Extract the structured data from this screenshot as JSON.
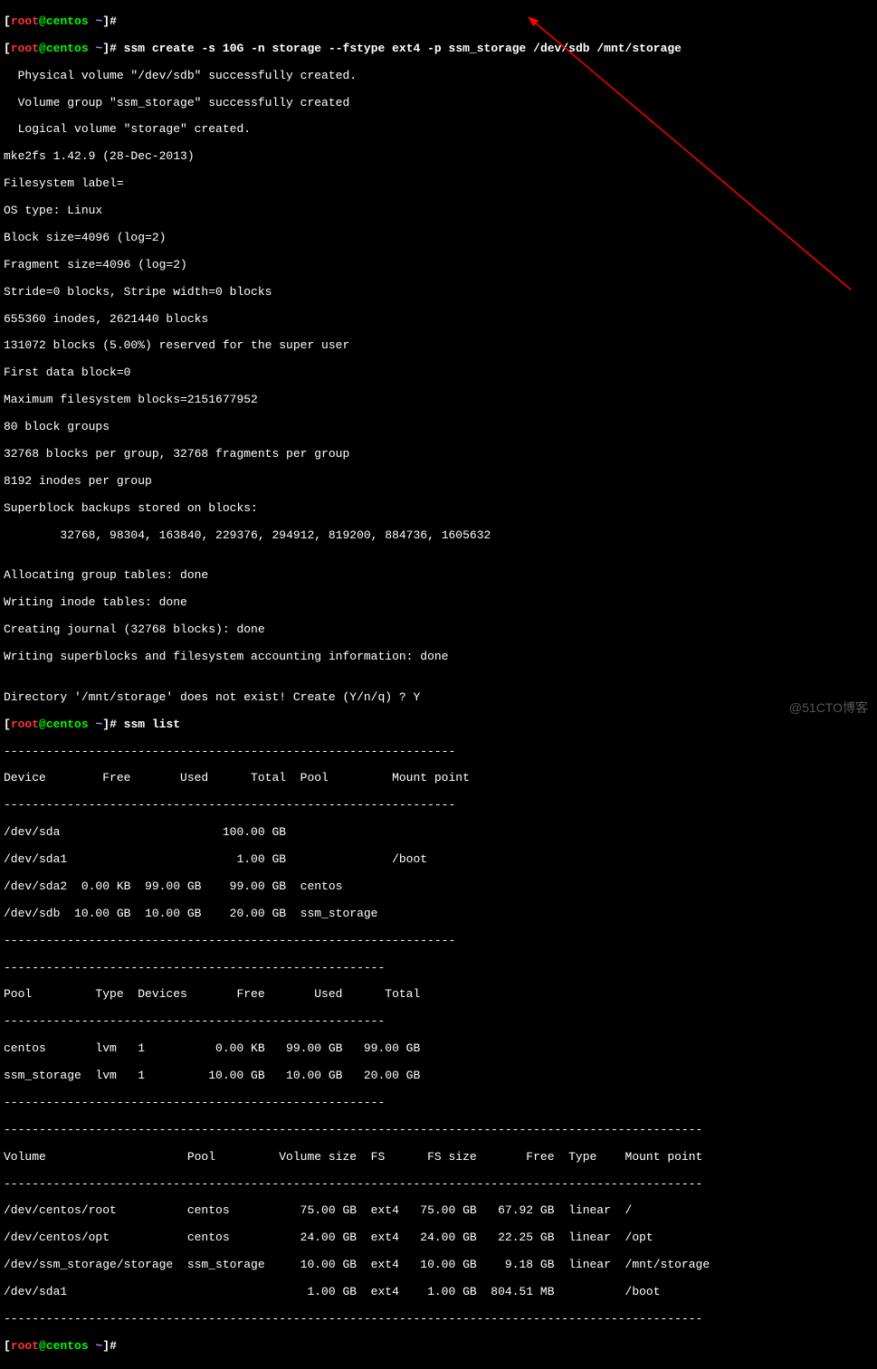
{
  "prompt1": {
    "user": "root",
    "at": "@",
    "host": "centos ",
    "tilde": "~",
    "cmd": "ssm create -s 10G -n storage --fstype ext4 -p ssm_storage /dev/sdb /mnt/storage"
  },
  "output1": [
    "  Physical volume \"/dev/sdb\" successfully created.",
    "  Volume group \"ssm_storage\" successfully created",
    "  Logical volume \"storage\" created.",
    "mke2fs 1.42.9 (28-Dec-2013)",
    "Filesystem label=",
    "OS type: Linux",
    "Block size=4096 (log=2)",
    "Fragment size=4096 (log=2)",
    "Stride=0 blocks, Stripe width=0 blocks",
    "655360 inodes, 2621440 blocks",
    "131072 blocks (5.00%) reserved for the super user",
    "First data block=0",
    "Maximum filesystem blocks=2151677952",
    "80 block groups",
    "32768 blocks per group, 32768 fragments per group",
    "8192 inodes per group",
    "Superblock backups stored on blocks: ",
    "\t32768, 98304, 163840, 229376, 294912, 819200, 884736, 1605632",
    "",
    "Allocating group tables: done                            ",
    "Writing inode tables: done                            ",
    "Creating journal (32768 blocks): done",
    "Writing superblocks and filesystem accounting information: done ",
    "",
    "Directory '/mnt/storage' does not exist! Create (Y/n/q) ? Y"
  ],
  "prompt2": {
    "user": "root",
    "at": "@",
    "host": "centos ",
    "tilde": "~",
    "cmd": "ssm list"
  },
  "devices": {
    "sep": "----------------------------------------------------------------",
    "header": "Device        Free       Used      Total  Pool         Mount point",
    "rows": [
      "/dev/sda                       100.00 GB                           ",
      "/dev/sda1                        1.00 GB               /boot       ",
      "/dev/sda2  0.00 KB  99.00 GB    99.00 GB  centos                   ",
      "/dev/sdb  10.00 GB  10.00 GB    20.00 GB  ssm_storage              "
    ]
  },
  "pools": {
    "sep": "------------------------------------------------------",
    "header": "Pool         Type  Devices       Free       Used      Total  ",
    "rows": [
      "centos       lvm   1          0.00 KB   99.00 GB   99.00 GB  ",
      "ssm_storage  lvm   1         10.00 GB   10.00 GB   20.00 GB  "
    ]
  },
  "volumes": {
    "sep": "---------------------------------------------------------------------------------------------------",
    "header": "Volume                    Pool         Volume size  FS      FS size       Free  Type    Mount point  ",
    "rows": [
      "/dev/centos/root          centos          75.00 GB  ext4   75.00 GB   67.92 GB  linear  /            ",
      "/dev/centos/opt           centos          24.00 GB  ext4   24.00 GB   22.25 GB  linear  /opt         ",
      "/dev/ssm_storage/storage  ssm_storage     10.00 GB  ext4   10.00 GB    9.18 GB  linear  /mnt/storage ",
      "/dev/sda1                                  1.00 GB  ext4    1.00 GB  804.51 MB          /boot        "
    ]
  },
  "prompt3": {
    "user": "root",
    "at": "@",
    "host": "centos ",
    "tilde": "~",
    "cmd": ""
  },
  "watermark": "@51CTO博客"
}
